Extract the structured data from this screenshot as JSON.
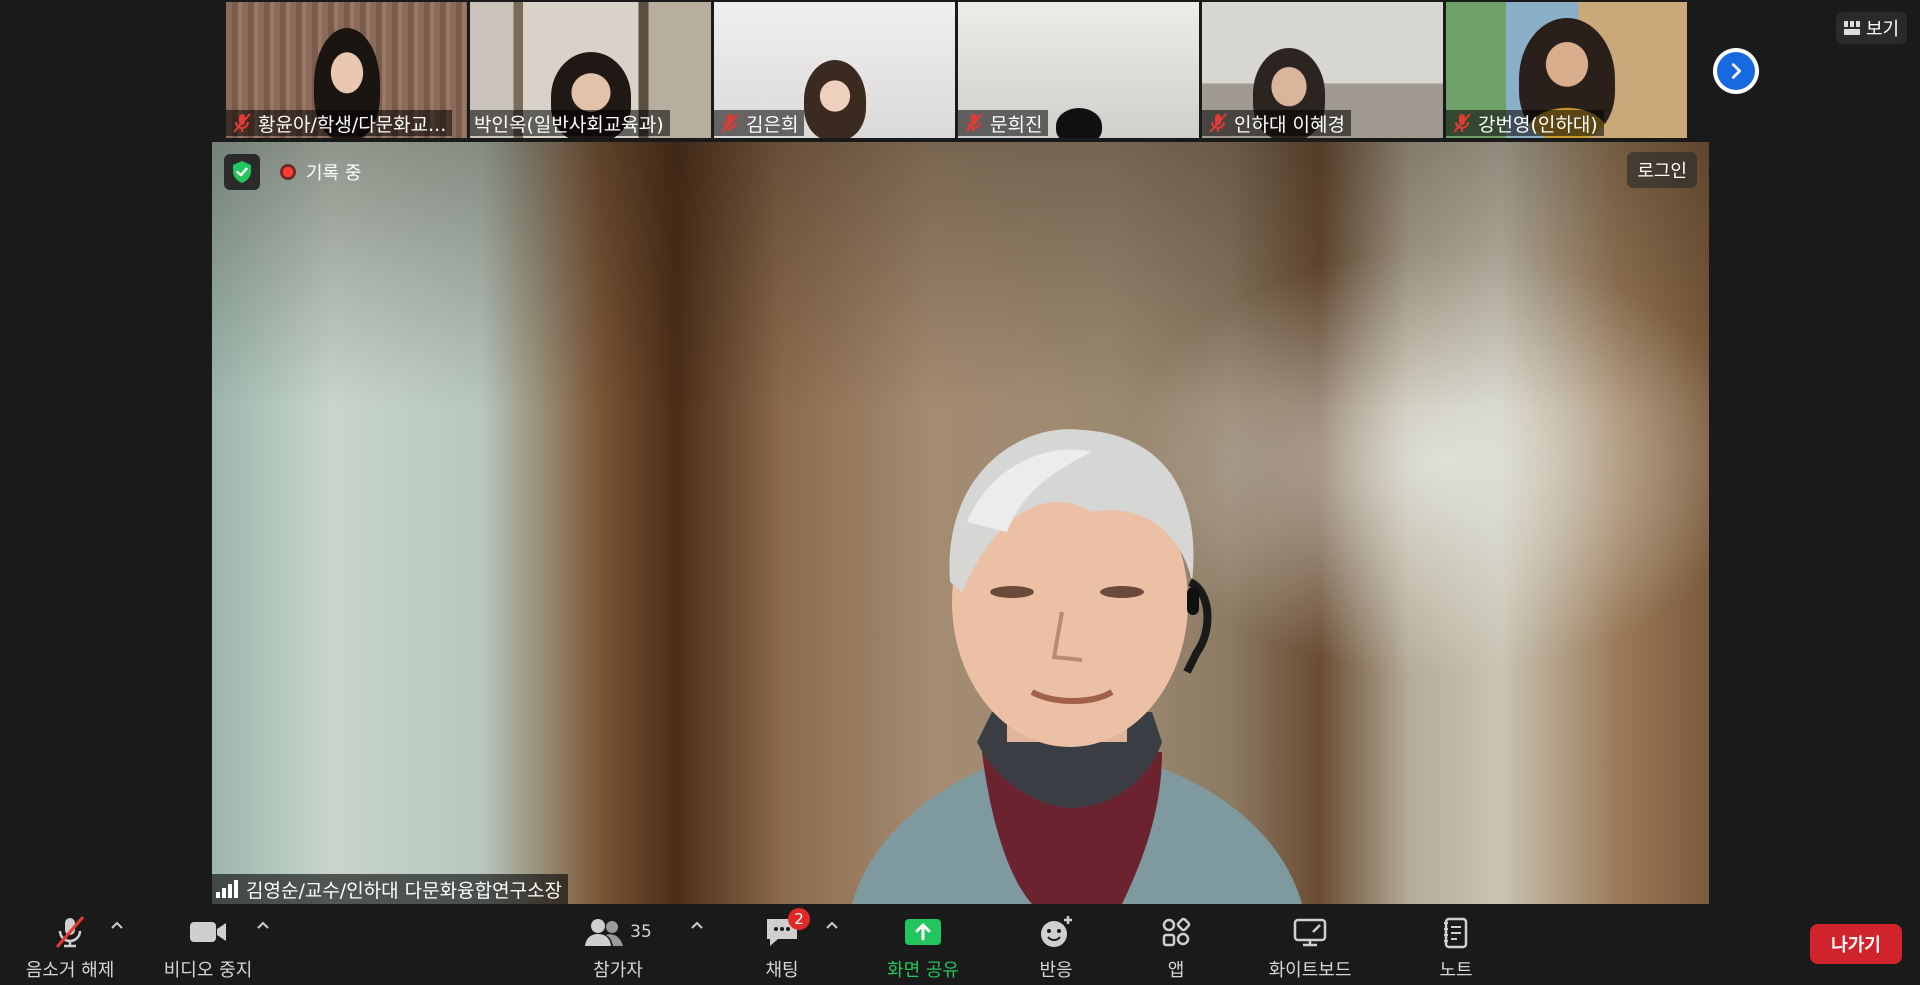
{
  "thumbnails": [
    {
      "name": "황윤아/학생/다문화교...",
      "muted": true
    },
    {
      "name": "박인옥(일반사회교육과)",
      "muted": false
    },
    {
      "name": "김은희",
      "muted": true
    },
    {
      "name": "문희진",
      "muted": true
    },
    {
      "name": "인하대 이혜경",
      "muted": true
    },
    {
      "name": "강번영(인하대)",
      "muted": true
    }
  ],
  "top": {
    "view_label": "보기"
  },
  "main": {
    "recording_label": "기록 중",
    "login_label": "로그인",
    "speaker_name": "김영순/교수/인하대 다문화융합연구소장"
  },
  "toolbar": {
    "mute_label": "음소거 해제",
    "video_label": "비디오 중지",
    "participants_label": "참가자",
    "participants_count": "35",
    "chat_label": "채팅",
    "chat_badge": "2",
    "share_label": "화면 공유",
    "reactions_label": "반응",
    "apps_label": "앱",
    "whiteboard_label": "화이트보드",
    "notes_label": "노트",
    "leave_label": "나가기"
  },
  "colors": {
    "accent_blue": "#1769e0",
    "share_green": "#22c55e",
    "leave_red": "#d1232b",
    "badge_red": "#e02828"
  }
}
